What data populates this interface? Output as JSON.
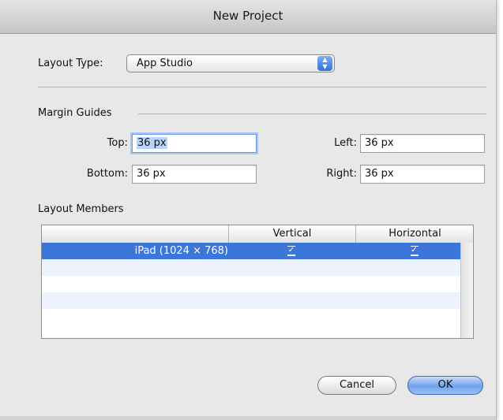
{
  "dialog": {
    "title": "New Project"
  },
  "layout_type": {
    "label": "Layout Type:",
    "value": "App Studio"
  },
  "margin_guides": {
    "heading": "Margin Guides",
    "top_label": "Top:",
    "top_value": "36 px",
    "bottom_label": "Bottom:",
    "bottom_value": "36 px",
    "left_label": "Left:",
    "left_value": "36 px",
    "right_label": "Right:",
    "right_value": "36 px"
  },
  "layout_members": {
    "heading": "Layout Members",
    "columns": [
      "",
      "Vertical",
      "Horizontal"
    ],
    "rows": [
      {
        "name": "iPad (1024 × 768)",
        "vertical": true,
        "horizontal": true,
        "selected": true
      }
    ]
  },
  "buttons": {
    "cancel": "Cancel",
    "ok": "OK"
  },
  "colors": {
    "selection": "#3d76d9",
    "alt_row": "#edf3fe",
    "default_button": "#6fa2ea"
  }
}
